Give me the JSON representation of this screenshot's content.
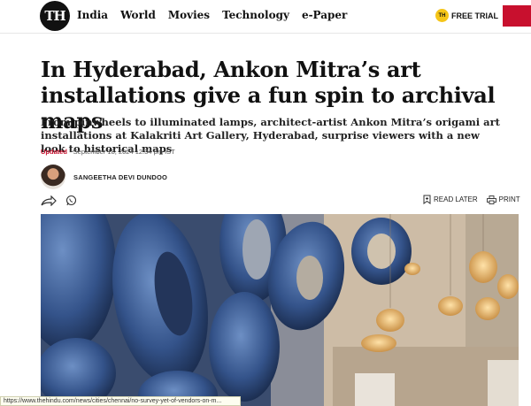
{
  "header": {
    "logo_text": "TH",
    "nav": [
      "India",
      "World",
      "Movies",
      "Technology",
      "e-Paper"
    ],
    "free_trial_badge": "TH",
    "free_trial_label": "FREE TRIAL"
  },
  "article": {
    "headline": "In Hyderabad, Ankon Mitra’s art installations give a fun spin to archival maps",
    "standfirst": "From pinwheels to illuminated lamps, architect-artist Ankon Mitra’s origami art installations at Kalakriti Art Gallery, Hyderabad, surprise viewers with a new look to historical maps",
    "updated_label": "Updated",
    "date": " - September 18, 2024 12:34 pm IST",
    "author": "SANGEETHA DEVI DUNDOO",
    "read_later": "READ LATER",
    "print": "PRINT"
  },
  "status_bar_url": "https://www.thehindu.com/news/cities/chennai/no-survey-yet-of-vendors-on-m...",
  "colors": {
    "accent_red": "#c8102e",
    "badge_yellow": "#f5c518"
  }
}
